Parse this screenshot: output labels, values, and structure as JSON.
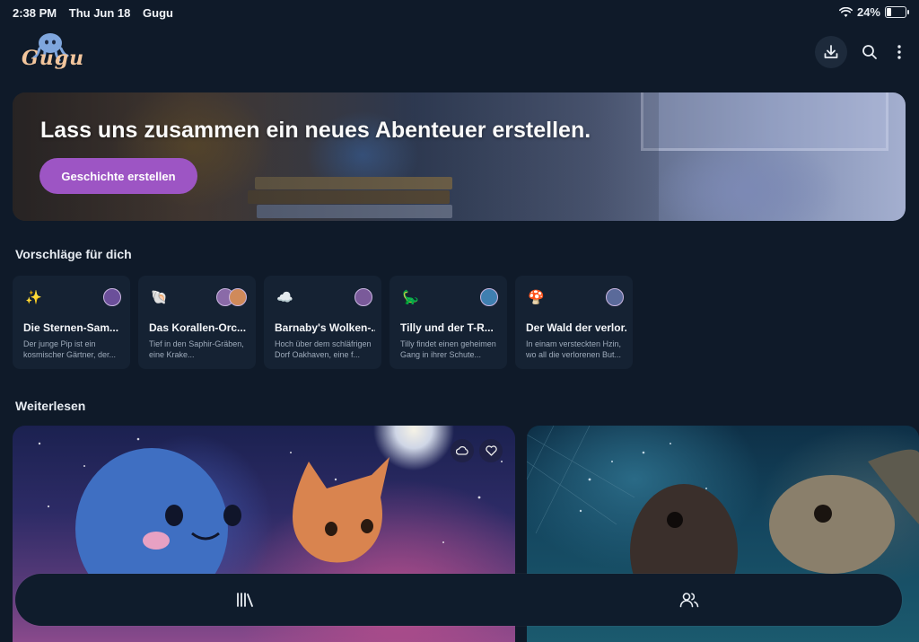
{
  "status_bar": {
    "time": "2:38 PM",
    "date": "Thu Jun 18",
    "app_name": "Gugu",
    "battery_percent": "24%",
    "battery_level": 0.24
  },
  "app": {
    "logo_text": "Gugu"
  },
  "header": {
    "icons": [
      "download-icon",
      "search-icon",
      "more-vertical-icon"
    ]
  },
  "hero": {
    "title": "Lass uns zusammen ein neues Abenteuer erstellen.",
    "button_label": "Geschichte erstellen"
  },
  "suggestions": {
    "title": "Vorschläge für dich",
    "items": [
      {
        "emoji": "✨",
        "title": "Die Sternen-Sam...",
        "description": "Der junge Pip ist ein kosmischer Gärtner, der...",
        "avatar_colors": [
          "#6b4f9a"
        ]
      },
      {
        "emoji": "🐚",
        "title": "Das Korallen-Orc...",
        "description": "Tief in den Saphir-Gräben, eine Krake...",
        "avatar_colors": [
          "#8a6aa8",
          "#d08a5a"
        ]
      },
      {
        "emoji": "☁️",
        "title": "Barnaby's Wolken-...",
        "description": "Hoch über dem schläfrigen Dorf Oakhaven, eine f...",
        "avatar_colors": [
          "#7a5a9a"
        ]
      },
      {
        "emoji": "🦕",
        "title": "Tilly und der T-R...",
        "description": "Tilly findet einen geheimen Gang in ihrer Schute...",
        "avatar_colors": [
          "#3f7fb0"
        ]
      },
      {
        "emoji": "🍄",
        "title": "Der Wald der verlor...",
        "description": "In einam versteckten Hzin, wo all die verlorenen But...",
        "avatar_colors": [
          "#5a6a9a"
        ]
      }
    ]
  },
  "continue_reading": {
    "title": "Weiterlesen",
    "books": [
      {
        "icons": [
          "cloud-sync-icon",
          "heart-icon"
        ]
      },
      {
        "icons": []
      }
    ]
  },
  "bottom_nav": {
    "items": [
      {
        "icon": "library-icon"
      },
      {
        "icon": "people-icon"
      }
    ]
  },
  "colors": {
    "background": "#0f1a29",
    "accent": "#9d55c4",
    "card": "#152233"
  }
}
